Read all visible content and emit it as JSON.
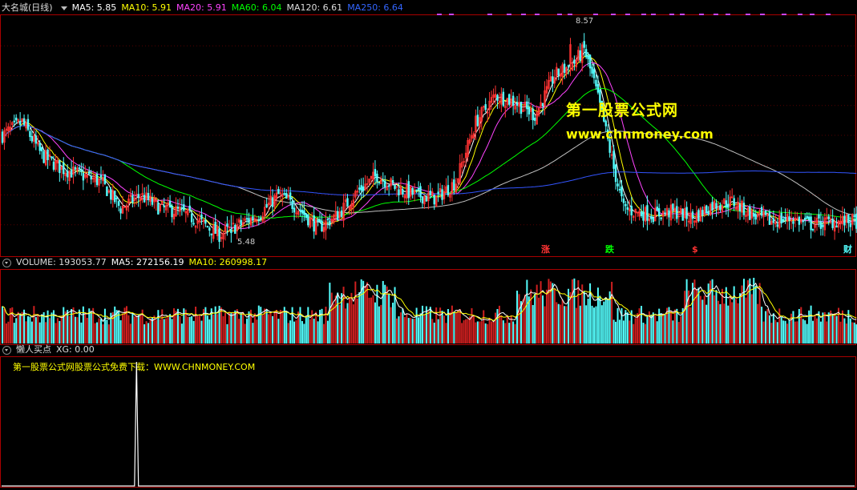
{
  "main_legend": {
    "title": "大名城(日线)",
    "ma5_label": "MA5: 5.85",
    "ma10_label": "MA10: 5.91",
    "ma20_label": "MA20: 5.91",
    "ma60_label": "MA60: 6.04",
    "ma120_label": "MA120: 6.61",
    "ma250_label": "MA250: 6.64"
  },
  "price_high_label": "8.57",
  "price_low_label": "5.48",
  "watermark": {
    "line1": "第一股票公式网",
    "line2": "www.chnmoney.com"
  },
  "event_tags": {
    "zhang": "涨",
    "die": "跌",
    "dollar": "$",
    "cai": "财"
  },
  "volume_legend": {
    "title": "VOLUME: 193053.77",
    "ma5_label": "MA5: 272156.19",
    "ma10_label": "MA10: 260998.17"
  },
  "indicator_legend": {
    "title": "懒人买点",
    "xg_label": "XG: 0.00",
    "note": "第一股票公式网股票公式免费下载：WWW.CHNMONEY.COM"
  },
  "colors": {
    "up": "#ff3333",
    "down": "#54ffff",
    "ma5": "#ffffff",
    "ma10": "#ffff00",
    "ma20": "#ff44ff",
    "ma60": "#00ff00",
    "ma120": "#c0c0c0",
    "ma250": "#3355ff",
    "border": "#aa0000"
  },
  "chart_data": {
    "type": "candlestick",
    "title": "大名城(日线)",
    "price_range": [
      5.3,
      8.9
    ],
    "price_high": 8.57,
    "price_low": 5.48,
    "close_keypoints": [
      [
        0,
        7.1
      ],
      [
        10,
        7.3
      ],
      [
        20,
        6.8
      ],
      [
        30,
        6.6
      ],
      [
        40,
        6.5
      ],
      [
        50,
        6.4
      ],
      [
        60,
        6.0
      ],
      [
        70,
        6.2
      ],
      [
        80,
        6.0
      ],
      [
        90,
        5.95
      ],
      [
        100,
        5.8
      ],
      [
        110,
        5.6
      ],
      [
        120,
        5.75
      ],
      [
        130,
        5.9
      ],
      [
        140,
        6.2
      ],
      [
        150,
        6.0
      ],
      [
        160,
        5.7
      ],
      [
        170,
        5.9
      ],
      [
        180,
        6.25
      ],
      [
        190,
        6.5
      ],
      [
        200,
        6.3
      ],
      [
        210,
        6.2
      ],
      [
        220,
        6.15
      ],
      [
        230,
        6.4
      ],
      [
        240,
        7.3
      ],
      [
        250,
        7.7
      ],
      [
        260,
        7.6
      ],
      [
        270,
        7.4
      ],
      [
        280,
        8.0
      ],
      [
        290,
        8.2
      ],
      [
        295,
        8.4
      ],
      [
        300,
        7.9
      ],
      [
        305,
        7.3
      ],
      [
        310,
        6.6
      ],
      [
        315,
        6.0
      ],
      [
        320,
        5.95
      ],
      [
        330,
        5.9
      ],
      [
        340,
        5.95
      ],
      [
        350,
        5.85
      ],
      [
        360,
        6.05
      ],
      [
        370,
        6.1
      ],
      [
        380,
        5.9
      ],
      [
        390,
        5.8
      ],
      [
        400,
        5.85
      ],
      [
        410,
        5.75
      ],
      [
        420,
        5.8
      ],
      [
        432,
        5.8
      ]
    ],
    "ma_lines": [
      {
        "name": "MA5",
        "value": 5.85
      },
      {
        "name": "MA10",
        "value": 5.91
      },
      {
        "name": "MA20",
        "value": 5.91
      },
      {
        "name": "MA60",
        "value": 6.04
      },
      {
        "name": "MA120",
        "value": 6.61
      },
      {
        "name": "MA250",
        "value": 6.64
      }
    ],
    "volume": {
      "last": 193053.77,
      "ma5": 272156.19,
      "ma10": 260998.17,
      "range": [
        0,
        420000
      ]
    },
    "indicator": {
      "name": "懒人买点",
      "xg": 0.0,
      "signal_index": 68,
      "signal_value": 1
    }
  }
}
